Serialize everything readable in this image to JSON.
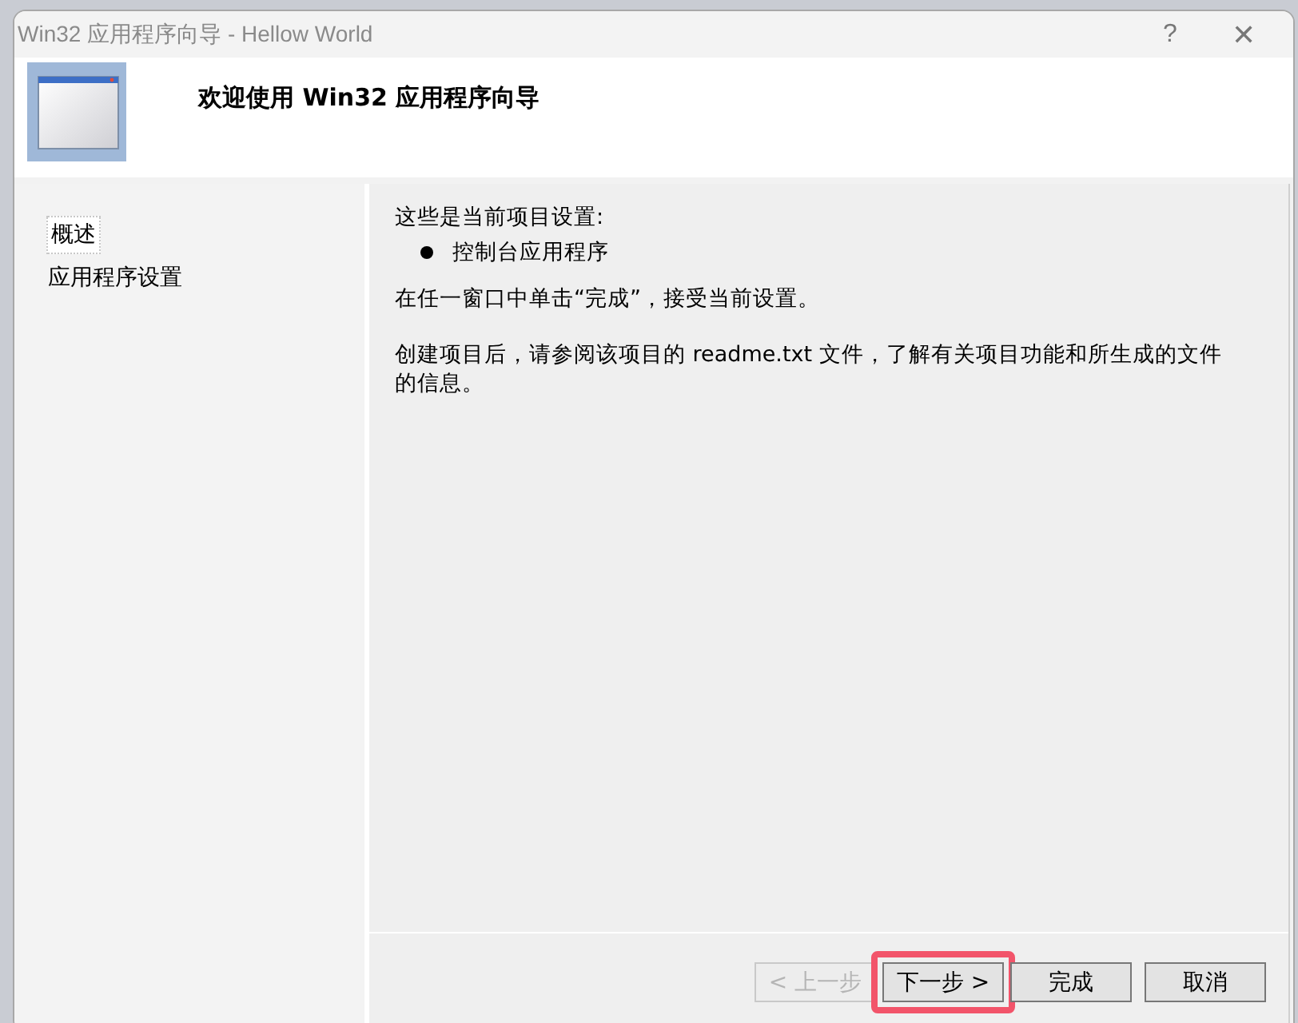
{
  "window": {
    "title": "Win32 应用程序向导 - Hellow World",
    "help": "?",
    "close": "✕"
  },
  "header": {
    "title": "欢迎使用 Win32 应用程序向导"
  },
  "sidebar": {
    "items": [
      {
        "label": "概述",
        "selected": true
      },
      {
        "label": "应用程序设置",
        "selected": false
      }
    ]
  },
  "content": {
    "heading": "这些是当前项目设置:",
    "bullets": [
      "控制台应用程序"
    ],
    "paragraphs": [
      "在任一窗口中单击“完成”，接受当前设置。",
      "创建项目后，请参阅该项目的 readme.txt 文件，了解有关项目功能和所生成的文件的信息。"
    ]
  },
  "buttons": [
    {
      "label": "< 上一步",
      "disabled": true,
      "highlighted": false
    },
    {
      "label": "下一步 >",
      "disabled": false,
      "highlighted": true
    },
    {
      "label": "完成",
      "disabled": false,
      "highlighted": false
    },
    {
      "label": "取消",
      "disabled": false,
      "highlighted": false
    }
  ]
}
